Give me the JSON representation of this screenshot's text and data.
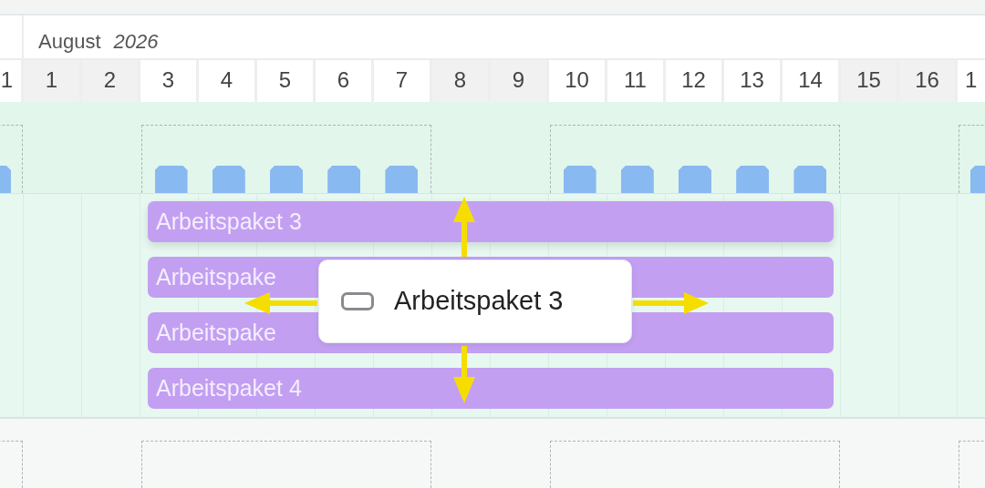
{
  "calendar": {
    "month": "August",
    "year": "2026"
  },
  "days": [
    {
      "label": "1",
      "weekend": false
    },
    {
      "label": "1",
      "weekend": true
    },
    {
      "label": "2",
      "weekend": true
    },
    {
      "label": "3",
      "weekend": false
    },
    {
      "label": "4",
      "weekend": false
    },
    {
      "label": "5",
      "weekend": false
    },
    {
      "label": "6",
      "weekend": false
    },
    {
      "label": "7",
      "weekend": false
    },
    {
      "label": "8",
      "weekend": true
    },
    {
      "label": "9",
      "weekend": true
    },
    {
      "label": "10",
      "weekend": false
    },
    {
      "label": "11",
      "weekend": false
    },
    {
      "label": "12",
      "weekend": false
    },
    {
      "label": "13",
      "weekend": false
    },
    {
      "label": "14",
      "weekend": false
    },
    {
      "label": "15",
      "weekend": true
    },
    {
      "label": "16",
      "weekend": true
    },
    {
      "label": "1",
      "weekend": false
    }
  ],
  "bars": [
    {
      "label": "Arbeitspaket 3"
    },
    {
      "label": "Arbeitspake"
    },
    {
      "label": "Arbeitspake"
    },
    {
      "label": "Arbeitspaket 4"
    }
  ],
  "drag_preview": {
    "label": "Arbeitspaket 3"
  }
}
